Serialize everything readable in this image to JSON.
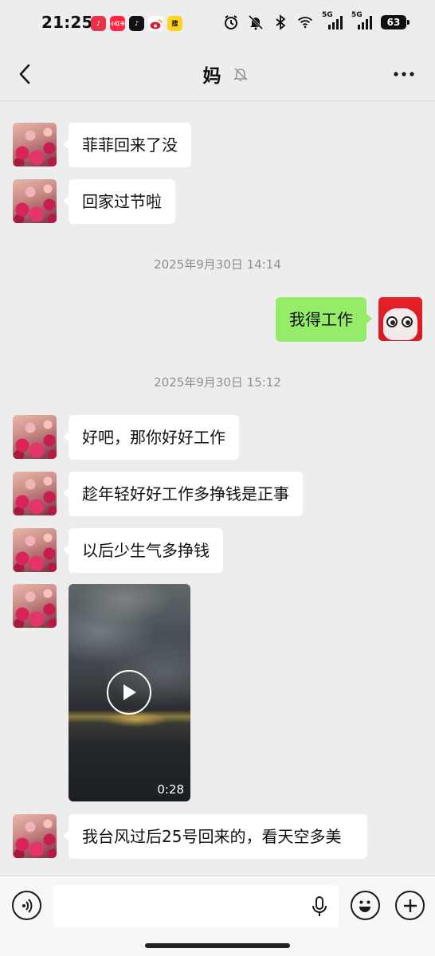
{
  "status_bar": {
    "time": "21:25",
    "battery": "63",
    "app_icons": [
      {
        "name": "music-app-icon",
        "color": "#e8324a",
        "glyph": "♪"
      },
      {
        "name": "xiaohongshu-app-icon",
        "color": "#ff2442",
        "glyph": "小红书"
      },
      {
        "name": "douyin-app-icon",
        "color": "#111111",
        "glyph": "♪"
      },
      {
        "name": "weibo-app-icon",
        "color": "#f5f5f5",
        "glyph": "微"
      },
      {
        "name": "news-app-icon",
        "color": "#ffd21f",
        "glyph": "搜"
      }
    ],
    "network_labels": [
      "5G",
      "5G"
    ]
  },
  "nav": {
    "title": "妈"
  },
  "messages": [
    {
      "type": "in",
      "text": "菲菲回来了没"
    },
    {
      "type": "in",
      "text": "回家过节啦"
    },
    {
      "type": "time",
      "text": "2025年9月30日 14:14"
    },
    {
      "type": "out",
      "text": "我得工作"
    },
    {
      "type": "time",
      "text": "2025年9月30日 15:12"
    },
    {
      "type": "in",
      "text": "好吧，那你好好工作"
    },
    {
      "type": "in",
      "text": "趁年轻好好工作多挣钱是正事"
    },
    {
      "type": "in",
      "text": "以后少生气多挣钱"
    },
    {
      "type": "video",
      "duration": "0:28"
    },
    {
      "type": "in",
      "text": "我台风过后25号回来的，看天空多美"
    }
  ],
  "input": {
    "value": "",
    "placeholder": ""
  },
  "colors": {
    "background": "#ededed",
    "incoming_bubble": "#ffffff",
    "outgoing_bubble": "#95ec69",
    "timestamp": "#8f8f8f"
  }
}
